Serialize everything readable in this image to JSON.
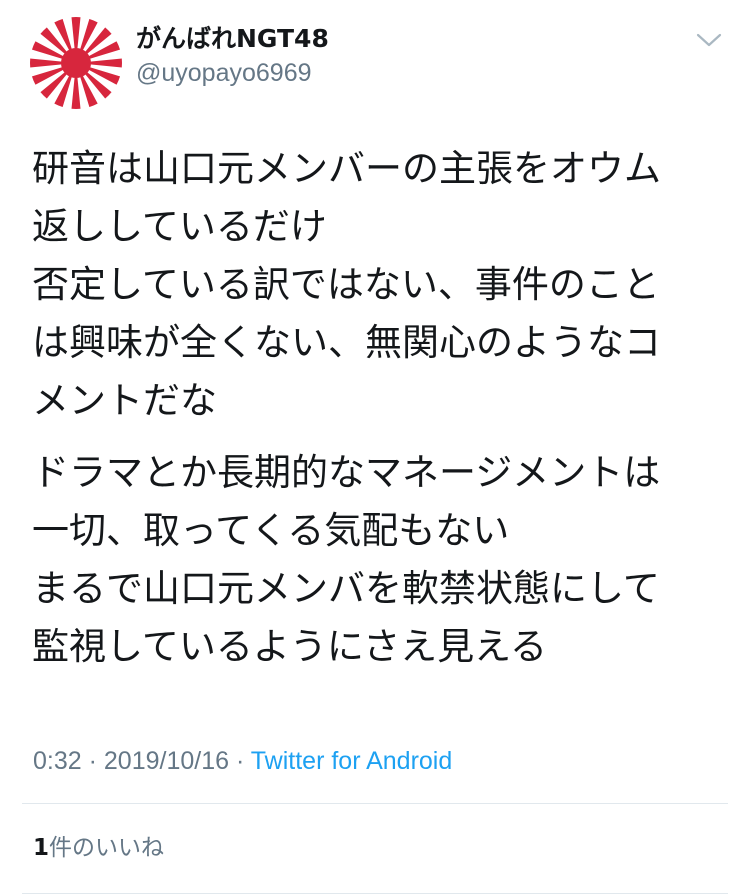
{
  "user": {
    "display_name": "がんばれNGT48",
    "handle": "@uyopayo6969",
    "avatar_icon": "rising-sun-flag-icon"
  },
  "tweet": {
    "paragraphs": [
      [
        "研音は山口元メンバーの主張をオウム",
        "返ししているだけ",
        "否定している訳ではない、事件のこと",
        "は興味が全くない、無関心のようなコ",
        "メントだな"
      ],
      [
        "ドラマとか長期的なマネージメントは",
        "一切、取ってくる気配もない",
        "まるで山口元メンバを軟禁状態にして",
        "監視しているようにさえ見える"
      ]
    ]
  },
  "meta": {
    "time": "0:32",
    "separator": " · ",
    "date": "2019/10/16",
    "source": "Twitter for Android"
  },
  "likes": {
    "count": "1",
    "label": "件のいいね"
  },
  "colors": {
    "text": "#14171a",
    "secondary": "#657786",
    "link": "#1da1f2",
    "divider": "#e1e8ed",
    "avatar_red": "#d7263d"
  }
}
